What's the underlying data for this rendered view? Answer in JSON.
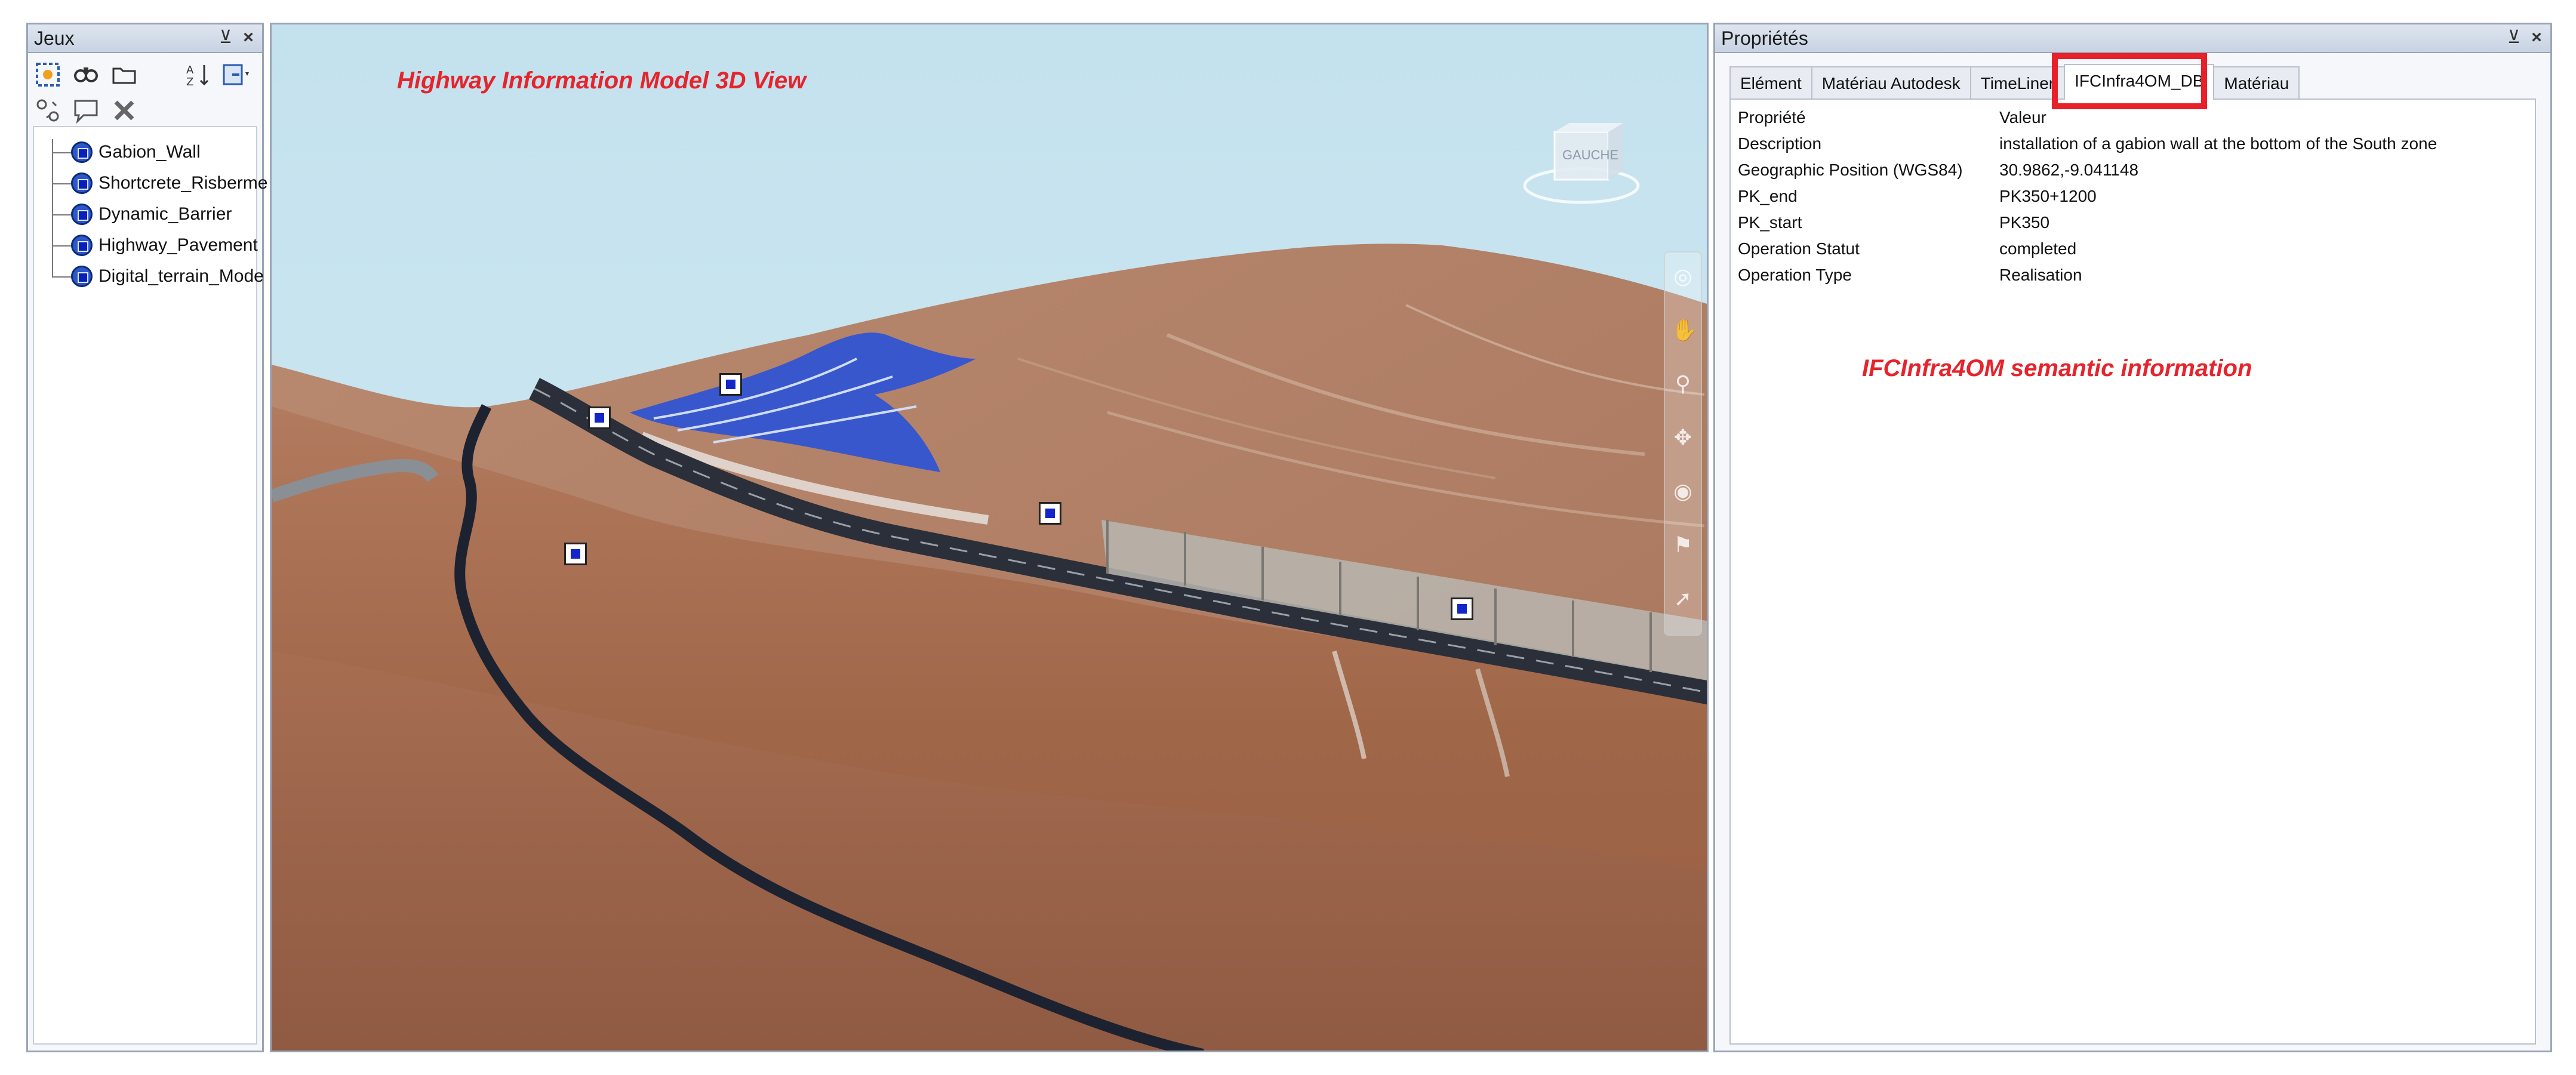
{
  "left_panel": {
    "title": "Jeux",
    "pin_symbol": "⊻",
    "close_symbol": "×",
    "sets": [
      {
        "label": "Gabion_Wall"
      },
      {
        "label": "Shortcrete_Risberme"
      },
      {
        "label": "Dynamic_Barrier"
      },
      {
        "label": "Highway_Pavement"
      },
      {
        "label": "Digital_terrain_Mode"
      }
    ]
  },
  "viewport": {
    "title": "Highway Information Model 3D View",
    "viewcube_label": "GAUCHE"
  },
  "right_panel": {
    "title": "Propriétés",
    "pin_symbol": "⊻",
    "close_symbol": "×",
    "tabs": [
      {
        "label": "Elément"
      },
      {
        "label": "Matériau Autodesk"
      },
      {
        "label": "TimeLiner"
      },
      {
        "label": "IFCInfra4OM_DB"
      },
      {
        "label": "Matériau"
      }
    ],
    "active_tab": "IFCInfra4OM_DB",
    "header": {
      "key": "Propriété",
      "value": "Valeur"
    },
    "properties": [
      {
        "key": "Description",
        "value": "installation of a gabion wall at the bottom of the South zone"
      },
      {
        "key": "Geographic Position (WGS84)",
        "value": "30.9862,-9.041148"
      },
      {
        "key": "PK_end",
        "value": "PK350+1200"
      },
      {
        "key": "PK_start",
        "value": "PK350"
      },
      {
        "key": "Operation Statut",
        "value": "completed"
      },
      {
        "key": "Operation Type",
        "value": "Realisation"
      }
    ],
    "semantic_note": "IFCInfra4OM semantic information"
  },
  "colors": {
    "annotation_red": "#e5242c",
    "sky": "#c4e2ee",
    "terrain": "#a86a4f",
    "road": "#2a2f3a",
    "selection_blue": "#1327c8"
  }
}
